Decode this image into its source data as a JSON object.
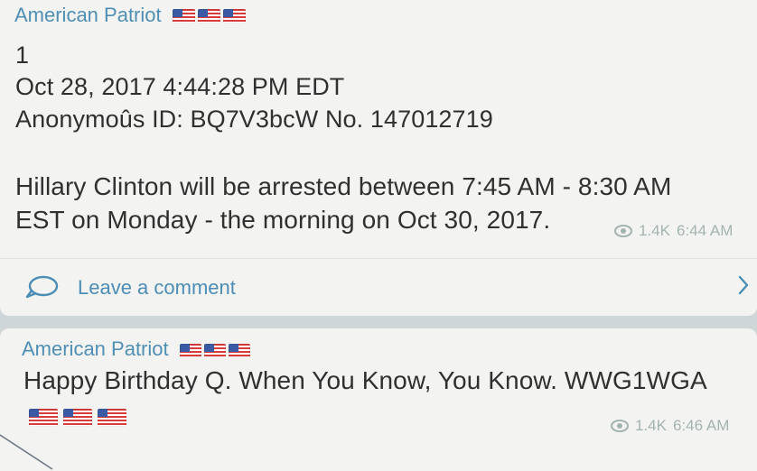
{
  "messages": [
    {
      "sender": "American Patriot",
      "flag_emojis": [
        "us-flag-icon",
        "us-flag-icon",
        "us-flag-icon"
      ],
      "number": "1",
      "date": "Oct 28, 2017 4:44:28 PM EDT",
      "anon_id": "Anonymoûs ID: BQ7V3bcW No. 147012719",
      "body_line1": "Hillary Clinton will be arrested between 7:45 AM - 8:30 AM",
      "body_line2": "EST on Monday - the morning on Oct 30, 2017.",
      "views": "1.4K",
      "time": "6:44 AM",
      "comment_label": "Leave a comment"
    },
    {
      "sender": "American Patriot",
      "flag_emojis": [
        "us-flag-icon",
        "us-flag-icon",
        "us-flag-icon"
      ],
      "body_line1": "Happy Birthday Q. When You Know, You Know. WWG1WGA",
      "body_flags": [
        "us-flag-icon",
        "us-flag-icon",
        "us-flag-icon"
      ],
      "views": "1.4K",
      "time": "6:46 AM"
    }
  ],
  "colors": {
    "background": "#cfd6d8",
    "bubble": "#f3f3f1",
    "sender": "#4f8fb4",
    "link": "#4c8db5",
    "meta": "#a3b3b0",
    "text": "#303030"
  },
  "icons": {
    "views": "eye-icon",
    "comment": "comment-bubble-icon",
    "chevron": "chevron-right-icon"
  }
}
